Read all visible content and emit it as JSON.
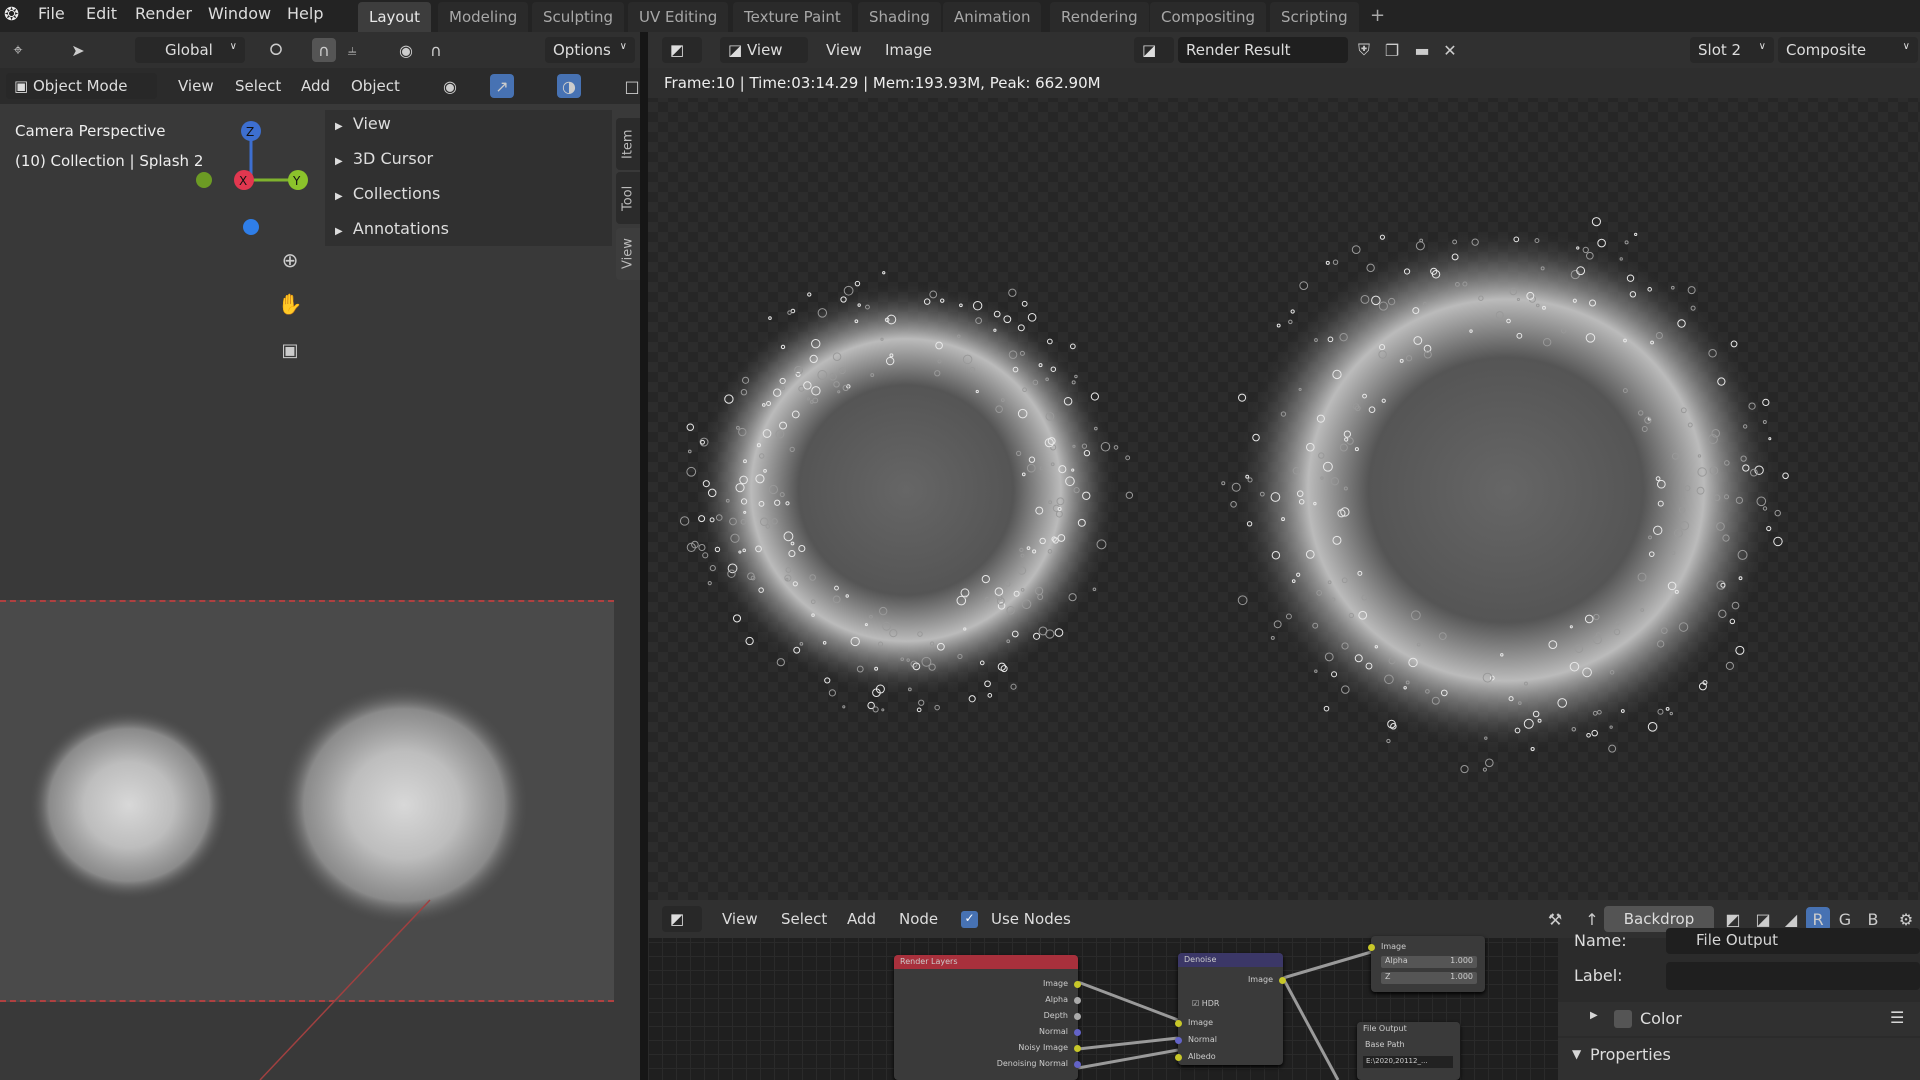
{
  "top_menu": [
    "File",
    "Edit",
    "Render",
    "Window",
    "Help"
  ],
  "workspaces": [
    "Layout",
    "Modeling",
    "Sculpting",
    "UV Editing",
    "Texture Paint",
    "Shading",
    "Animation",
    "Rendering",
    "Compositing",
    "Scripting",
    "+"
  ],
  "viewport_toolbar": {
    "transform_orientation": "Global",
    "options": "Options"
  },
  "viewport_header": {
    "mode": "Object Mode",
    "menus": [
      "View",
      "Select",
      "Add",
      "Object"
    ]
  },
  "viewport": {
    "overlay_line1": "Camera Perspective",
    "overlay_line2": "(10) Collection | Splash 2",
    "gizmo": {
      "x": "X",
      "y": "Y",
      "z": "Z"
    }
  },
  "npanel": {
    "sections": [
      "View",
      "3D Cursor",
      "Collections",
      "Annotations"
    ],
    "tabs": [
      "Item",
      "Tool",
      "View"
    ]
  },
  "image_editor": {
    "view_mode": "View",
    "menus": [
      "View",
      "Image"
    ],
    "image_name": "Render Result",
    "slot": "Slot 2",
    "layer": "Composite",
    "status": "Frame:10 | Time:03:14.29 | Mem:193.93M, Peak: 662.90M"
  },
  "node_editor": {
    "menus": [
      "View",
      "Select",
      "Add",
      "Node"
    ],
    "use_nodes_label": "Use Nodes",
    "use_nodes": true,
    "backdrop": "Backdrop",
    "channels": [
      "R",
      "G",
      "B"
    ],
    "nodes": {
      "render_layers": {
        "title": "Render Layers",
        "outputs": [
          "Image",
          "Alpha",
          "Depth",
          "Normal",
          "Noisy Image",
          "Denoising Normal"
        ]
      },
      "denoise": {
        "title": "Denoise",
        "output": "Image",
        "hdr": "HDR",
        "inputs": [
          "Image",
          "Normal",
          "Albedo"
        ]
      },
      "composite": {
        "input": "Image",
        "alpha_label": "Alpha",
        "alpha": "1.000",
        "z_label": "Z",
        "z": "1.000"
      },
      "file_output": {
        "title": "File Output",
        "base_path_label": "Base Path",
        "base_path": "E:\\2020,20112_..."
      }
    }
  },
  "properties": {
    "name_label": "Name:",
    "name_value": "File Output",
    "label_label": "Label:",
    "label_value": "",
    "color": "Color",
    "properties": "Properties"
  },
  "colors": {
    "accent": "#4772b3",
    "render_layers_header": "#a8303c",
    "denoise_header": "#3b3767"
  }
}
